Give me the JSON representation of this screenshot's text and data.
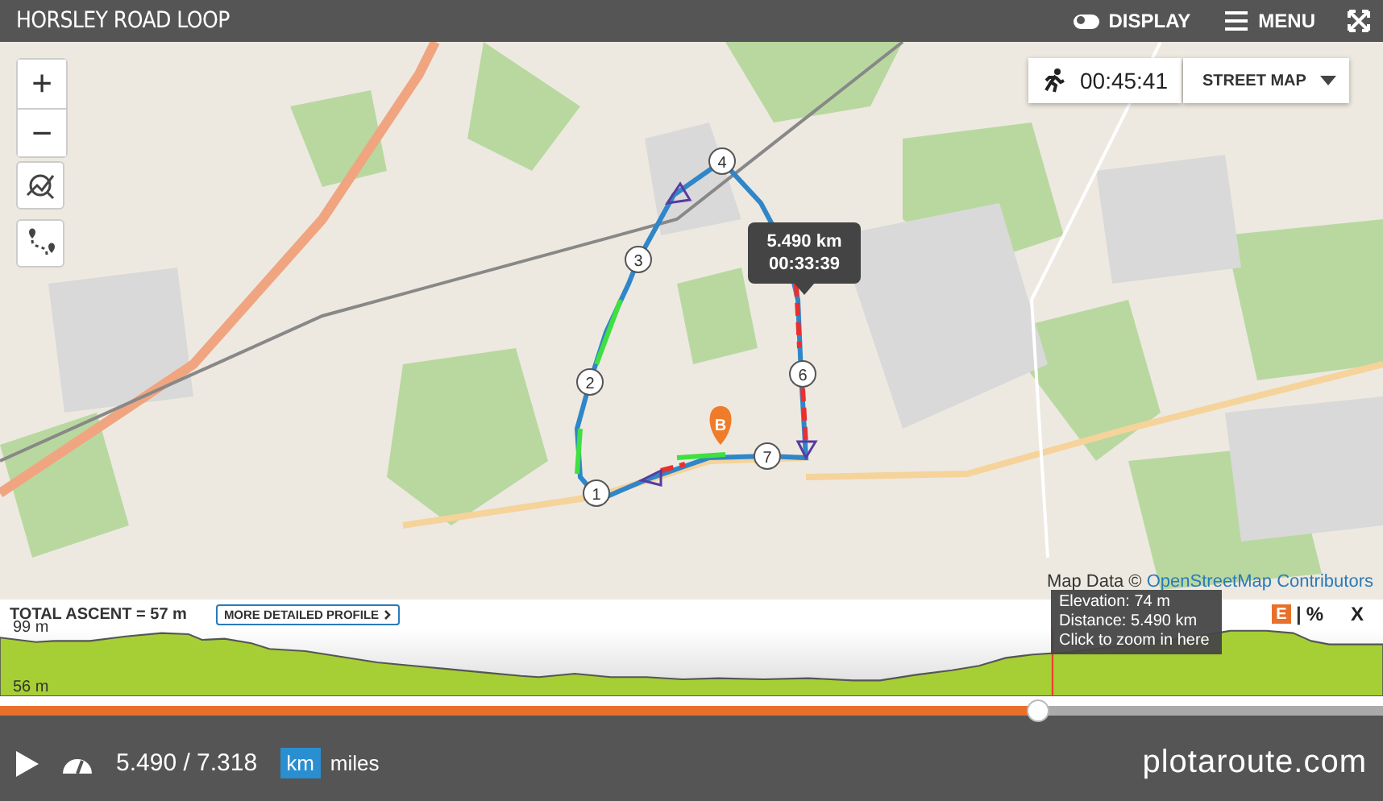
{
  "window": {
    "title": "HORSLEY ROAD LOOP"
  },
  "header_actions": [
    {
      "kind": "toggle",
      "label": "DISPLAY",
      "on": true
    },
    {
      "kind": "menu",
      "label": "MENU"
    },
    {
      "kind": "fullscreen"
    }
  ],
  "map": {
    "zoom_in": "+",
    "zoom_out": "−",
    "timer": "00:45:41",
    "layer_select": "STREET MAP",
    "waypoints": [
      "1",
      "2",
      "3",
      "4",
      "6",
      "7"
    ],
    "end_marker": "B",
    "tooltip": {
      "distance": "5.490 km",
      "time": "00:33:39"
    },
    "attribution": {
      "text": "Map Data ©",
      "link": "OpenStreetMap Contributors"
    }
  },
  "profile": {
    "total_ascent": "TOTAL ASCENT = 57 m",
    "detail_button": "MORE DETAILED PROFILE",
    "grade_toggle": "E",
    "separator": "|",
    "percent_toggle": "%",
    "close": "X",
    "max_label": "99 m",
    "min_label": "56 m",
    "hover": {
      "elevation": "Elevation: 74 m",
      "distance": "Distance: 5.490 km",
      "hint": "Click to zoom in here"
    }
  },
  "playback": {
    "level": 0.75,
    "distance": "5.490 / 7.318",
    "units": [
      {
        "label": "km",
        "selected": true
      },
      {
        "label": "miles",
        "selected": false
      }
    ],
    "logo": "plotaroute.com"
  }
}
